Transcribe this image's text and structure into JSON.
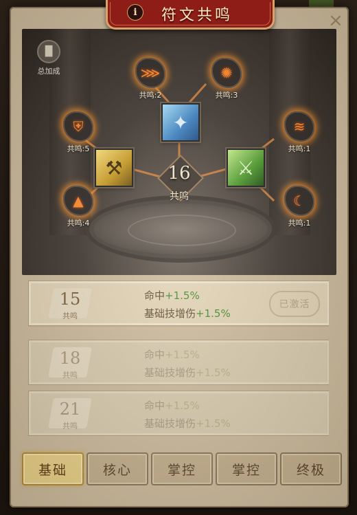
{
  "title": "符文共鸣",
  "info_icon": "info-icon",
  "close_icon": "close-icon",
  "total_bonus": {
    "label": "总加成",
    "icon": "bars-icon"
  },
  "core": {
    "value": "16",
    "label": "共鸣"
  },
  "nodes": [
    {
      "label": "共鸣:2",
      "icon": "claw-icon"
    },
    {
      "label": "共鸣:3",
      "icon": "swirl-icon"
    },
    {
      "label": "共鸣:5",
      "icon": "shield-icon"
    },
    {
      "label": "共鸣:1",
      "icon": "slash-icon"
    },
    {
      "label": "共鸣:4",
      "icon": "flame-icon"
    },
    {
      "label": "共鸣:1",
      "icon": "crescent-icon"
    }
  ],
  "runes": [
    {
      "icon": "blue-rune-icon"
    },
    {
      "icon": "gold-rune-icon"
    },
    {
      "icon": "green-rune-icon"
    }
  ],
  "tiers": [
    {
      "num": "15",
      "sub": "共鸣",
      "line1": "命中",
      "plus1": "+1.5%",
      "line2": "基础技增伤",
      "plus2": "+1.5%",
      "status": "已激活"
    },
    {
      "num": "18",
      "sub": "共鸣",
      "line1": "命中",
      "plus1": "+1.5%",
      "line2": "基础技增伤",
      "plus2": "+1.5%"
    },
    {
      "num": "21",
      "sub": "共鸣",
      "line1": "命中",
      "plus1": "+1.5%",
      "line2": "基础技增伤",
      "plus2": "+1.5%"
    }
  ],
  "tabs": [
    "基础",
    "核心",
    "掌控",
    "掌控",
    "终极"
  ],
  "active_tab": "基础",
  "colors": {
    "accent": "#f08a24",
    "banner": "#8e1d17",
    "active_tab": "#e8cf86"
  }
}
